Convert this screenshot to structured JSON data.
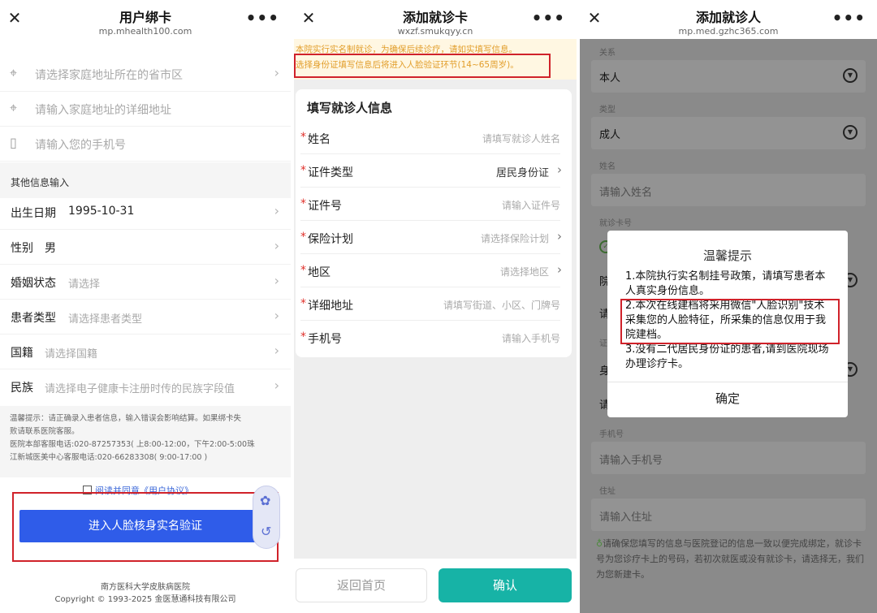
{
  "panel1": {
    "title": "用户绑卡",
    "url": "mp.mhealth100.com",
    "address_region_ph": "请选择家庭地址所在的省市区",
    "address_detail_ph": "请输入家庭地址的详细地址",
    "phone_ph": "请输入您的手机号",
    "section_title": "其他信息输入",
    "birth_label": "出生日期",
    "birth_value": "1995-10-31",
    "gender_label": "性别",
    "gender_value": "男",
    "marital_label": "婚姻状态",
    "marital_ph": "请选择",
    "patient_type_label": "患者类型",
    "patient_type_ph": "请选择患者类型",
    "nationality_label": "国籍",
    "nationality_ph": "请选择国籍",
    "ethnicity_label": "民族",
    "ethnicity_ph": "请选择电子健康卡注册时传的民族字段值",
    "tip_line1": "温馨提示：请正确录入患者信息，输入错误会影响结算。如果绑卡失",
    "tip_line2": "败请联系医院客服。",
    "tip_line3": "医院本部客服电话:020-87257353( 上8:00-12:00，下午2:00-5:00珠",
    "tip_line4": "江新城医美中心客服电话:020-66283308( 9:00-17:00 )",
    "agree_text": "阅读并同意《用户协议》",
    "verify_button": "进入人脸核身实名验证",
    "footer_line1": "南方医科大学皮肤病医院",
    "footer_line2": "Copyright © 1993-2025 金医慧通科技有限公司"
  },
  "panel2": {
    "title": "添加就诊卡",
    "url": "wxzf.smukqyy.cn",
    "warn_line1": "本院实行实名制就诊，为确保后续诊疗，请如实填写信息。",
    "warn_line2": "选择身份证填写信息后将进入人脸验证环节(14~65周岁)。",
    "card_title": "填写就诊人信息",
    "rows": [
      {
        "label": "姓名",
        "ph": "请填写就诊人姓名"
      },
      {
        "label": "证件类型",
        "val": "居民身份证"
      },
      {
        "label": "证件号",
        "ph": "请输入证件号"
      },
      {
        "label": "保险计划",
        "ph": "请选择保险计划"
      },
      {
        "label": "地区",
        "ph": "请选择地区"
      },
      {
        "label": "详细地址",
        "ph": "请填写街道、小区、门牌号"
      },
      {
        "label": "手机号",
        "ph": "请输入手机号"
      }
    ],
    "btn_home": "返回首页",
    "btn_ok": "确认"
  },
  "panel3": {
    "title": "添加就诊人",
    "url": "mp.med.gzhc365.com",
    "relation_label": "关系",
    "relation_value": "本人",
    "type_label": "类型",
    "type_value": "成人",
    "name_label": "姓名",
    "name_ph": "请输入姓名",
    "card_label": "就诊卡号",
    "frag1": "院",
    "frag2": "请",
    "frag3": "证",
    "frag4": "身",
    "frag5": "请",
    "phone_label": "手机号",
    "phone_ph": "请输入手机号",
    "address_label": "住址",
    "address_ph": "请输入住址",
    "note": "请确保您填写的信息与医院登记的信息一致以便完成绑定，就诊卡号为您诊疗卡上的号码，若初次就医或没有就诊卡，请选择无，我们为您新建卡。",
    "modal_title": "温馨提示",
    "modal_p1": "1.本院执行实名制挂号政策，请填写患者本人真实身份信息。",
    "modal_p2": "2.本次在线建档将采用微信\"人脸识别\"技术采集您的人脸特征，所采集的信息仅用于我院建档。",
    "modal_p3": "3.没有二代居民身份证的患者,请到医院现场办理诊疗卡。",
    "modal_ok": "确定"
  },
  "icons": {
    "close": "✕",
    "more": "•••",
    "chevron": "›",
    "location": "⌖",
    "phone": "▯"
  }
}
